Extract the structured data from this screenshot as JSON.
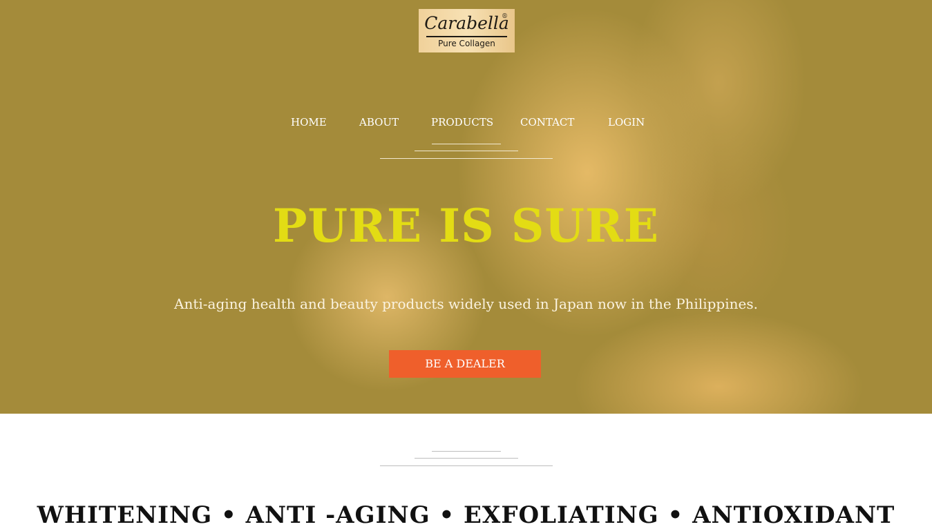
{
  "brand": {
    "name": "Carabella",
    "registered": "®",
    "tagline": "Pure Collagen"
  },
  "nav": {
    "items": [
      {
        "label": "HOME"
      },
      {
        "label": "ABOUT"
      },
      {
        "label": "PRODUCTS"
      },
      {
        "label": "CONTACT"
      },
      {
        "label": "LOGIN"
      }
    ]
  },
  "hero": {
    "title": "PURE IS SURE",
    "subtitle": "Anti-aging health and beauty products widely used in Japan now in the Philippines.",
    "cta_label": "BE A DEALER"
  },
  "features": {
    "text": "WHITENING • ANTI -AGING • EXFOLIATING • ANTIOXIDANT"
  },
  "colors": {
    "hero_overlay": "#a48c3a",
    "title": "#e3dc14",
    "cta": "#ef5f2b",
    "text_dark": "#111111"
  }
}
